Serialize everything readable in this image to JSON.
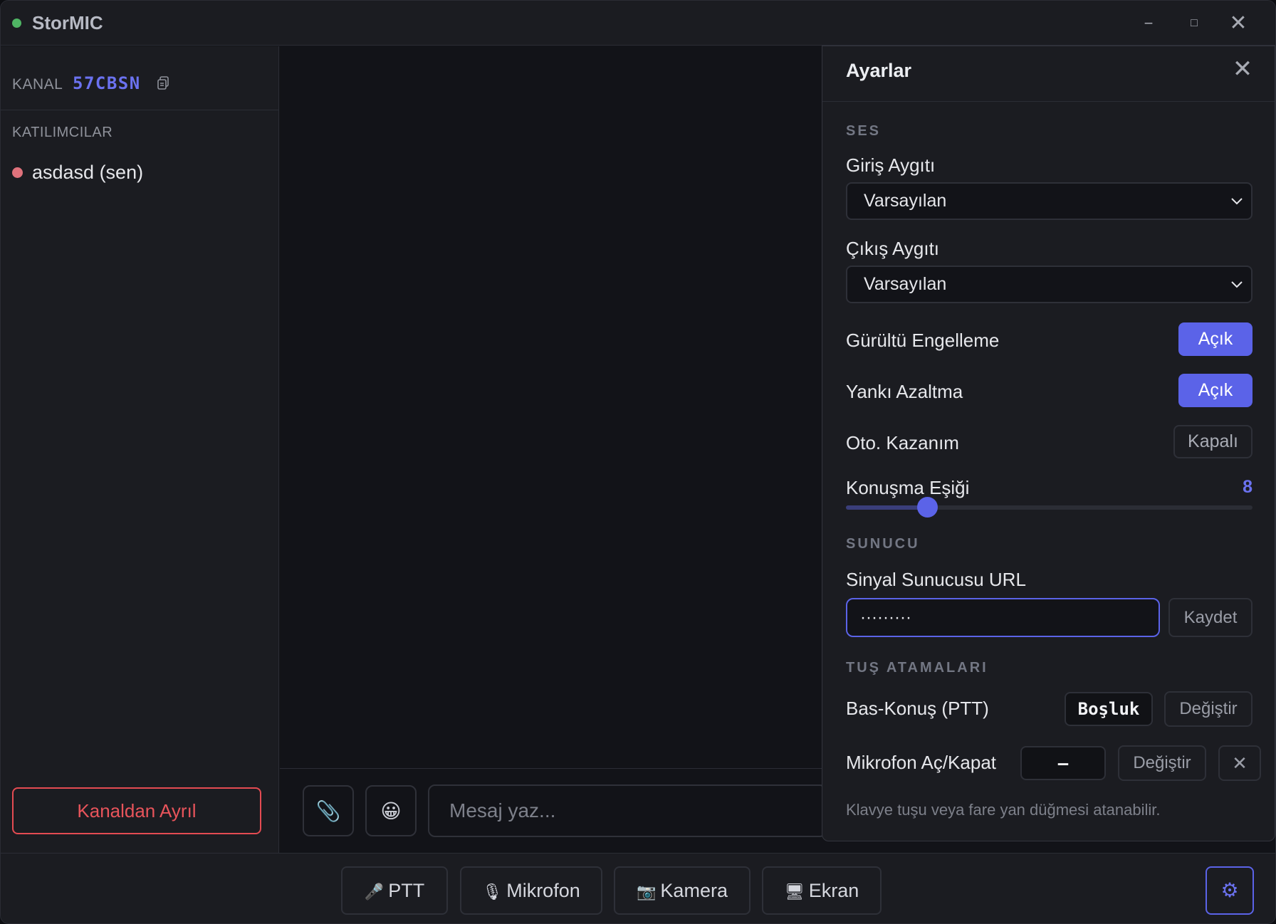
{
  "app": {
    "title": "StorMIC"
  },
  "window_controls": {
    "minimize": "−",
    "maximize": "□",
    "close": "✕"
  },
  "sidebar": {
    "channel_label": "KANAL",
    "channel_code": "57CBSN",
    "participants_title": "KATILIMCILAR",
    "participants": [
      {
        "name": "asdasd (sen)",
        "status_color": "#e0727c"
      }
    ],
    "leave_button": "Kanaldan Ayrıl"
  },
  "chat": {
    "attach_icon": "📎",
    "emoji_icon": "😀",
    "message_placeholder": "Mesaj yaz..."
  },
  "bottom_bar": {
    "ptt": {
      "icon": "🎤",
      "label": "PTT"
    },
    "microphone": {
      "icon": "🎙",
      "label": "Mikrofon"
    },
    "camera": {
      "icon": "📷",
      "label": "Kamera"
    },
    "screen": {
      "icon": "🖥",
      "label": "Ekran"
    },
    "settings_icon": "⚙"
  },
  "settings": {
    "title": "Ayarlar",
    "close_icon": "✕",
    "audio_section": "SES",
    "input_device_label": "Giriş Aygıtı",
    "input_device_value": "Varsayılan",
    "output_device_label": "Çıkış Aygıtı",
    "output_device_value": "Varsayılan",
    "noise_suppression_label": "Gürültü Engelleme",
    "noise_suppression_value": "Açık",
    "echo_cancel_label": "Yankı Azaltma",
    "echo_cancel_value": "Açık",
    "auto_gain_label": "Oto. Kazanım",
    "auto_gain_value": "Kapalı",
    "speech_threshold_label": "Konuşma Eşiği",
    "speech_threshold_value": "8",
    "speech_threshold_fraction": 0.2,
    "server_section": "SUNUCU",
    "signal_url_label": "Sinyal Sunucusu URL",
    "signal_url_value": "·········",
    "save_button": "Kaydet",
    "keys_section": "TUŞ ATAMALARI",
    "ptt_label": "Bas-Konuş (PTT)",
    "ptt_key": "Boşluk",
    "ptt_change": "Değiştir",
    "mic_toggle_label": "Mikrofon Aç/Kapat",
    "mic_toggle_key": "–",
    "mic_toggle_change": "Değiştir",
    "mic_toggle_clear": "✕",
    "hint": "Klavye tuşu veya fare yan düğmesi atanabilir."
  },
  "colors": {
    "accent": "#5b63e8",
    "danger": "#e44b52",
    "online": "#4fb564"
  }
}
